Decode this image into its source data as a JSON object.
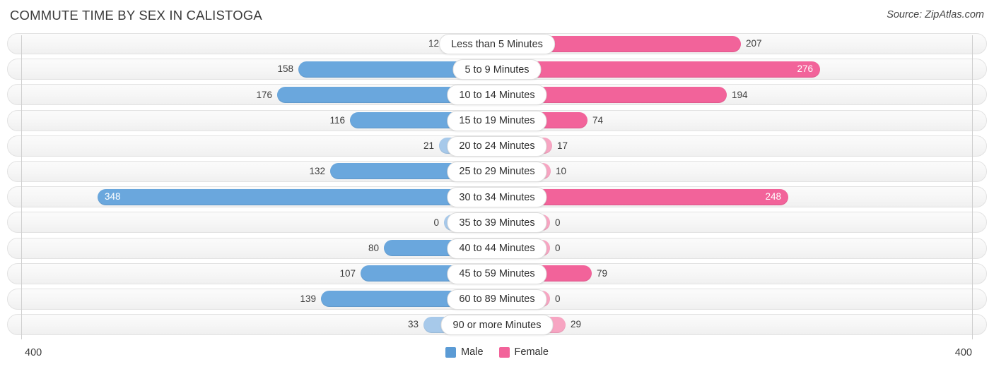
{
  "header": {
    "title": "COMMUTE TIME BY SEX IN CALISTOGA",
    "source": "Source: ZipAtlas.com"
  },
  "legend": {
    "male_label": "Male",
    "female_label": "Female",
    "male_color": "#5b9bd5",
    "female_color": "#f2639a"
  },
  "axis": {
    "left_tick": "400",
    "right_tick": "400",
    "max": 400
  },
  "colors": {
    "male_strong": "#6aa7dd",
    "male_light": "#a7c9ea",
    "female_strong": "#f2639a",
    "female_light": "#f7a5c2",
    "track": "#f4f4f4",
    "track_border": "#e2e2e2",
    "label_bg": "#ffffff"
  },
  "chart_data": {
    "type": "bar",
    "orientation": "horizontal-diverging",
    "title": "COMMUTE TIME BY SEX IN CALISTOGA",
    "xlabel": "",
    "ylabel": "",
    "xlim": [
      400,
      400
    ],
    "grid": false,
    "legend_position": "bottom-center",
    "categories": [
      "Less than 5 Minutes",
      "5 to 9 Minutes",
      "10 to 14 Minutes",
      "15 to 19 Minutes",
      "20 to 24 Minutes",
      "25 to 29 Minutes",
      "30 to 34 Minutes",
      "35 to 39 Minutes",
      "40 to 44 Minutes",
      "45 to 59 Minutes",
      "60 to 89 Minutes",
      "90 or more Minutes"
    ],
    "series": [
      {
        "name": "Male",
        "color": "#5b9bd5",
        "values": [
          12,
          158,
          176,
          116,
          21,
          132,
          348,
          0,
          80,
          107,
          139,
          33
        ]
      },
      {
        "name": "Female",
        "color": "#f2639a",
        "values": [
          207,
          276,
          194,
          74,
          17,
          10,
          248,
          0,
          0,
          79,
          0,
          29
        ]
      }
    ]
  },
  "rows": [
    {
      "label": "Less than 5 Minutes",
      "male": "12",
      "female": "207",
      "male_w": 75,
      "female_w": 345,
      "male_inside": false,
      "female_inside": false,
      "male_tone": "light",
      "female_tone": "strong"
    },
    {
      "label": "5 to 9 Minutes",
      "male": "158",
      "female": "276",
      "male_w": 281,
      "female_w": 457,
      "male_inside": false,
      "female_inside": true,
      "male_tone": "strong",
      "female_tone": "strong"
    },
    {
      "label": "10 to 14 Minutes",
      "male": "176",
      "female": "194",
      "male_w": 311,
      "female_w": 325,
      "male_inside": false,
      "female_inside": false,
      "male_tone": "strong",
      "female_tone": "strong"
    },
    {
      "label": "15 to 19 Minutes",
      "male": "116",
      "female": "74",
      "male_w": 208,
      "female_w": 128,
      "male_inside": false,
      "female_inside": false,
      "male_tone": "strong",
      "female_tone": "strong"
    },
    {
      "label": "20 to 24 Minutes",
      "male": "21",
      "female": "17",
      "male_w": 82,
      "female_w": 78,
      "male_inside": false,
      "female_inside": false,
      "male_tone": "light",
      "female_tone": "light"
    },
    {
      "label": "25 to 29 Minutes",
      "male": "132",
      "female": "10",
      "male_w": 236,
      "female_w": 76,
      "male_inside": false,
      "female_inside": false,
      "male_tone": "strong",
      "female_tone": "light"
    },
    {
      "label": "30 to 34 Minutes",
      "male": "348",
      "female": "248",
      "male_w": 565,
      "female_w": 412,
      "male_inside": true,
      "female_inside": true,
      "male_tone": "strong",
      "female_tone": "strong"
    },
    {
      "label": "35 to 39 Minutes",
      "male": "0",
      "female": "0",
      "male_w": 75,
      "female_w": 75,
      "male_inside": false,
      "female_inside": false,
      "male_tone": "light",
      "female_tone": "light"
    },
    {
      "label": "40 to 44 Minutes",
      "male": "80",
      "female": "0",
      "male_w": 160,
      "female_w": 75,
      "male_inside": false,
      "female_inside": false,
      "male_tone": "strong",
      "female_tone": "light"
    },
    {
      "label": "45 to 59 Minutes",
      "male": "107",
      "female": "79",
      "male_w": 193,
      "female_w": 134,
      "male_inside": false,
      "female_inside": false,
      "male_tone": "strong",
      "female_tone": "strong"
    },
    {
      "label": "60 to 89 Minutes",
      "male": "139",
      "female": "0",
      "male_w": 249,
      "female_w": 75,
      "male_inside": false,
      "female_inside": false,
      "male_tone": "strong",
      "female_tone": "light"
    },
    {
      "label": "90 or more Minutes",
      "male": "33",
      "female": "29",
      "male_w": 104,
      "female_w": 97,
      "male_inside": false,
      "female_inside": false,
      "male_tone": "light",
      "female_tone": "light"
    }
  ]
}
